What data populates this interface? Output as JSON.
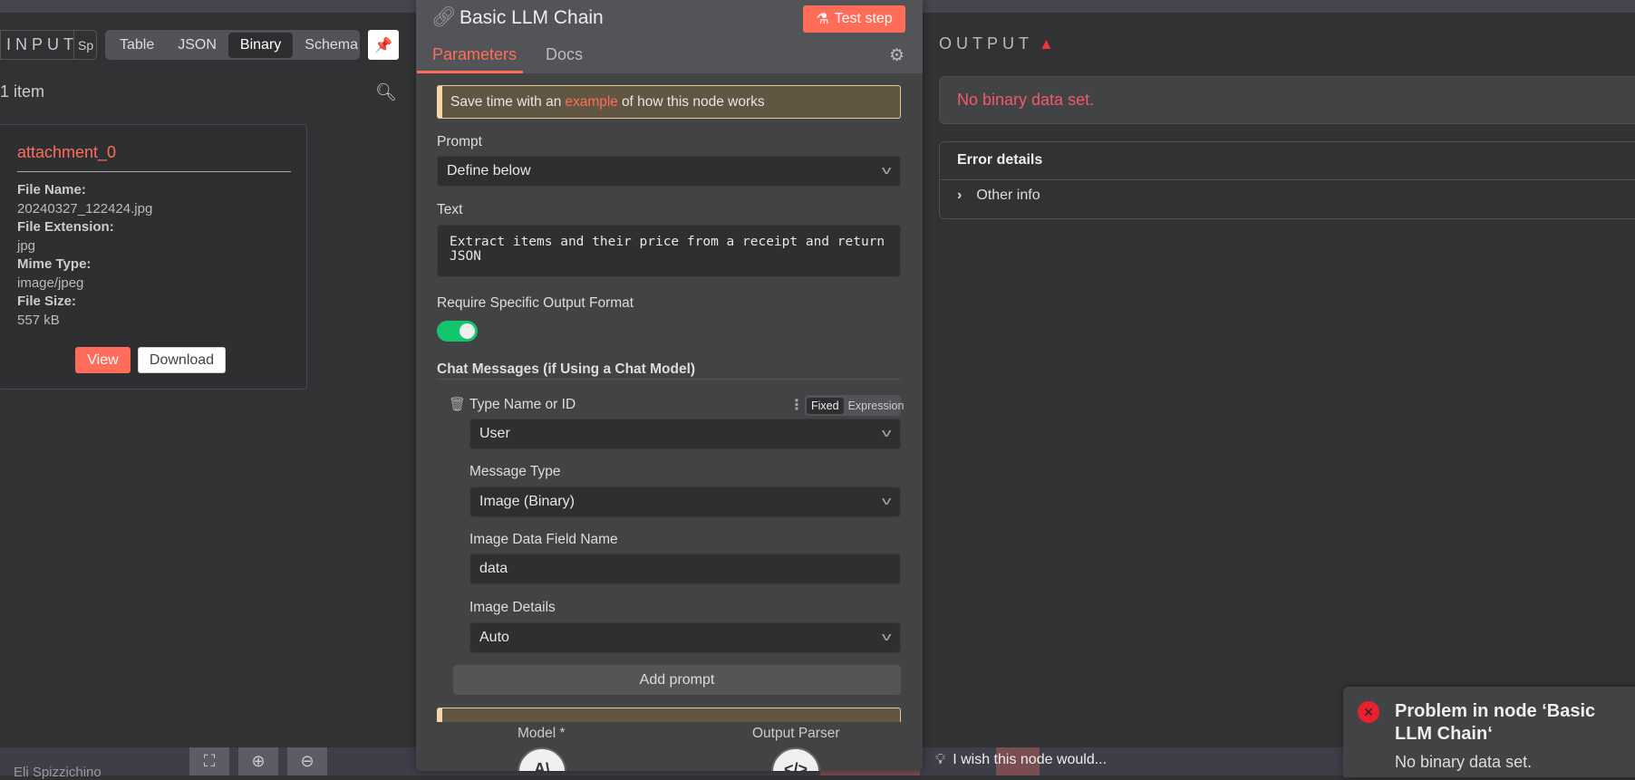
{
  "input": {
    "label": "INPUT",
    "split_label": "Sp",
    "tabs": [
      "Table",
      "JSON",
      "Binary",
      "Schema"
    ],
    "active_tab": "Binary",
    "count": "1 item",
    "card": {
      "name": "attachment_0",
      "fields": [
        {
          "k": "File Name:",
          "v": "20240327_122424.jpg"
        },
        {
          "k": "File Extension:",
          "v": "jpg"
        },
        {
          "k": "Mime Type:",
          "v": "image/jpeg"
        },
        {
          "k": "File Size:",
          "v": "557 kB"
        }
      ],
      "view": "View",
      "download": "Download"
    }
  },
  "node": {
    "title": "Basic LLM Chain",
    "test_step": "Test step",
    "tabs": {
      "params": "Parameters",
      "docs": "Docs"
    },
    "banner": {
      "pre": "Save time with an",
      "link": "example",
      "post": "of how this node works"
    },
    "prompt_label": "Prompt",
    "prompt_value": "Define below",
    "text_label": "Text",
    "text_value": "Extract items and their price from a receipt and return JSON",
    "require_label": "Require Specific Output Format",
    "require_on": true,
    "chat_section": "Chat Messages (if Using a Chat Model)",
    "type_label": "Type Name or ID",
    "fixed": "Fixed",
    "expression": "Expression",
    "type_value": "User",
    "msgtype_label": "Message Type",
    "msgtype_value": "Image (Binary)",
    "field_label": "Image Data Field Name",
    "field_value": "data",
    "details_label": "Image Details",
    "details_value": "Auto",
    "add_prompt": "Add prompt",
    "model_label": "Model *",
    "parser_label": "Output Parser"
  },
  "output": {
    "label": "OUTPUT",
    "error": "No binary data set.",
    "error_details": "Error details",
    "other_info": "Other info"
  },
  "canvas": {
    "user": "Eli Spizzichino",
    "wish": "I wish this node would..."
  },
  "toast": {
    "title": "Problem in node ‘Basic LLM Chain‘",
    "message": "No binary data set."
  },
  "colors": {
    "accent": "#ff6d5a",
    "error": "#f2596a",
    "toggle": "#13c66b"
  }
}
